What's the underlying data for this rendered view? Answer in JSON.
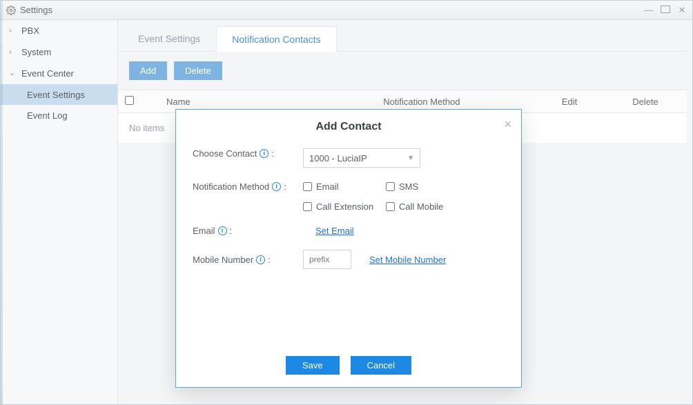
{
  "window": {
    "title": "Settings"
  },
  "sidebar": {
    "items": [
      {
        "label": "PBX"
      },
      {
        "label": "System"
      },
      {
        "label": "Event Center"
      }
    ],
    "subs": [
      {
        "label": "Event Settings"
      },
      {
        "label": "Event Log"
      }
    ]
  },
  "tabs": [
    {
      "label": "Event Settings"
    },
    {
      "label": "Notification Contacts"
    }
  ],
  "toolbar": {
    "add": "Add",
    "delete": "Delete"
  },
  "table": {
    "cols": {
      "name": "Name",
      "method": "Notification Method",
      "edit": "Edit",
      "delete": "Delete"
    },
    "empty": "No items"
  },
  "modal": {
    "title": "Add Contact",
    "choose_label": "Choose Contact",
    "contact_selected": "1000 - LuciaIP",
    "notif_label": "Notification Method",
    "checks": {
      "email": "Email",
      "sms": "SMS",
      "callext": "Call Extension",
      "callmob": "Call Mobile"
    },
    "email_label": "Email",
    "set_email": "Set Email",
    "mobile_label": "Mobile Number",
    "prefix_placeholder": "prefix",
    "set_mobile": "Set Mobile Number",
    "save": "Save",
    "cancel": "Cancel"
  }
}
